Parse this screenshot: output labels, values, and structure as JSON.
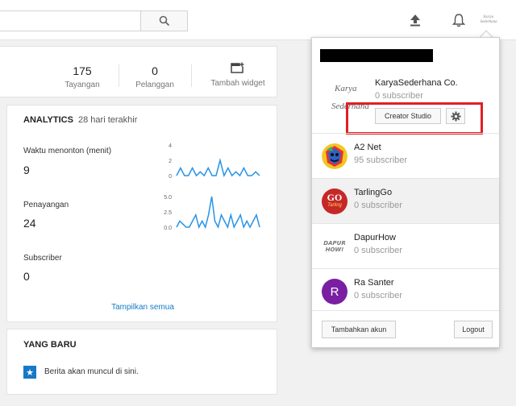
{
  "header": {
    "search_placeholder": "",
    "icons": [
      "search-icon",
      "upload-icon",
      "bell-icon"
    ],
    "avatar_text": [
      "Karya",
      "Sederhana"
    ]
  },
  "stats": [
    {
      "value": "175",
      "label": "Tayangan"
    },
    {
      "value": "0",
      "label": "Pelanggan"
    },
    {
      "value": "",
      "label": "Tambah widget"
    }
  ],
  "analytics": {
    "title": "ANALYTICS",
    "range": "28 hari terakhir",
    "show_all": "Tampilkan semua",
    "metrics": [
      {
        "label": "Waktu menonton (menit)",
        "value": "9",
        "ticks": [
          "4",
          "2",
          "0"
        ],
        "series": [
          0,
          1,
          0,
          0,
          1,
          0,
          0.5,
          0,
          1,
          0,
          0,
          2,
          0,
          1,
          0,
          0.5,
          0,
          1,
          0,
          0,
          0.5,
          0
        ],
        "ymax": 4
      },
      {
        "label": "Penayangan",
        "value": "24",
        "ticks": [
          "5.0",
          "2.5",
          "0.0"
        ],
        "series": [
          0,
          1,
          0.5,
          0,
          0,
          1,
          2,
          0,
          1,
          0,
          2,
          5,
          1,
          0,
          2,
          1,
          0,
          2,
          0,
          1,
          2,
          0,
          1,
          0,
          1,
          2,
          0
        ],
        "ymax": 5
      },
      {
        "label": "Subscriber",
        "value": "0"
      }
    ]
  },
  "whats_new": {
    "title": "YANG BARU",
    "item": "Berita akan muncul di sini."
  },
  "account_menu": {
    "current": {
      "avatar_text": [
        "Karya",
        "Sederhana"
      ],
      "name": "KaryaSederhana Co.",
      "subscribers": "0 subscriber",
      "creator_studio": "Creator Studio"
    },
    "accounts": [
      {
        "name": "A2 Net",
        "subscribers": "95 subscriber",
        "avatar": "a2net"
      },
      {
        "name": "TarlingGo",
        "subscribers": "0 subscriber",
        "avatar": "tarlinggo",
        "avatar_text": [
          "GO",
          "Tarling"
        ]
      },
      {
        "name": "DapurHow",
        "subscribers": "0 subscriber",
        "avatar": "dapurhow",
        "avatar_text": [
          "DAPUR",
          "HOW!"
        ]
      },
      {
        "name": "Ra Santer",
        "subscribers": "0 subscriber",
        "avatar": "letter",
        "avatar_text": [
          "R"
        ]
      }
    ],
    "add_account": "Tambahkan akun",
    "logout": "Logout"
  },
  "colors": {
    "accent_blue": "#167ac6",
    "highlight_red": "#e01f24",
    "chart_line": "#2793e6",
    "ra_santer_avatar": "#7b1fa2",
    "tarlinggo_avatar": "#c62828"
  }
}
